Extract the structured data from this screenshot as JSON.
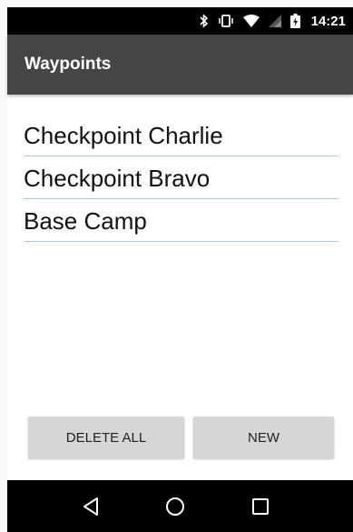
{
  "status_bar": {
    "time": "14:21",
    "icons": [
      "bluetooth-icon",
      "vibrate-icon",
      "wifi-icon",
      "signal-icon",
      "battery-charging-icon"
    ]
  },
  "app_bar": {
    "title": "Waypoints"
  },
  "waypoints": [
    {
      "label": "Checkpoint Charlie"
    },
    {
      "label": "Checkpoint Bravo"
    },
    {
      "label": "Base Camp"
    }
  ],
  "buttons": {
    "delete_all": "DELETE ALL",
    "new": "NEW"
  },
  "nav_bar": {
    "icons": [
      "back-icon",
      "home-icon",
      "recents-icon"
    ]
  },
  "colors": {
    "status_bar": "#000000",
    "app_bar": "#454545",
    "divider": "#a9cfe0",
    "button": "#d6d6d6",
    "nav_bar": "#000000"
  }
}
